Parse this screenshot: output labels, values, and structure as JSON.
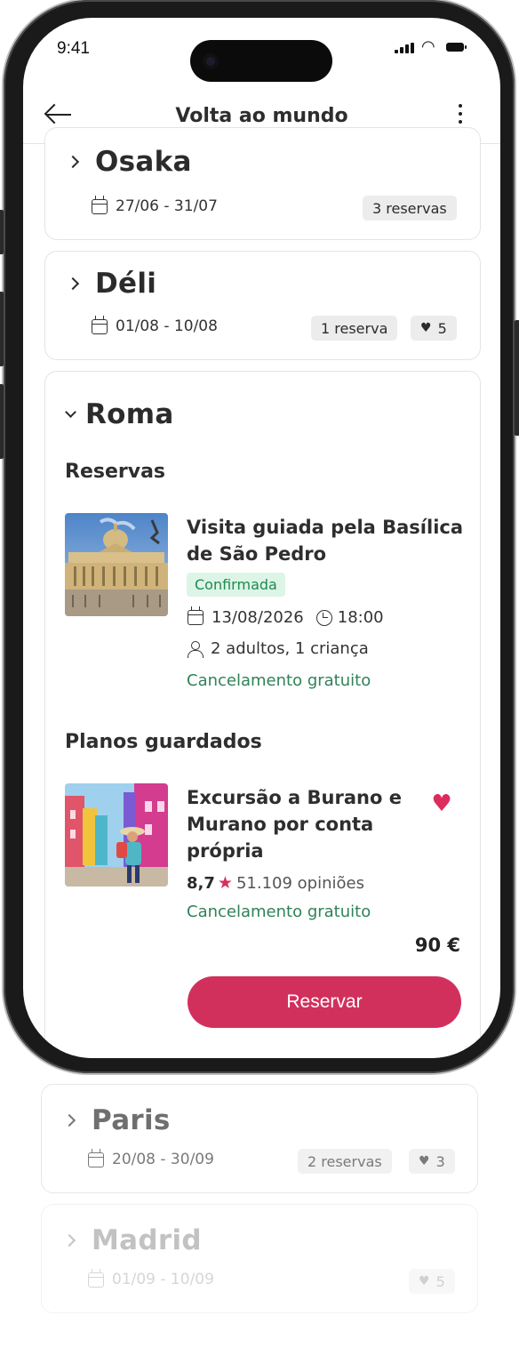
{
  "status_bar": {
    "time": "9:41"
  },
  "appbar": {
    "title": "Volta ao mundo",
    "back_icon": "arrow-left-icon",
    "menu_icon": "more-vertical-icon"
  },
  "destinations": [
    {
      "city": "Osaka",
      "dates": "27/06 - 31/07",
      "reservations": "3 reservas"
    },
    {
      "city": "Déli",
      "dates": "01/08 - 10/08",
      "reservations": "1 reserva",
      "saved": "5"
    },
    {
      "city": "Roma",
      "expanded": true
    },
    {
      "city": "Paris",
      "dates": "20/08 - 30/09",
      "reservations": "2 reservas",
      "saved": "3"
    },
    {
      "city": "Madrid",
      "dates": "01/09 - 10/09",
      "saved": "5"
    }
  ],
  "roma": {
    "reservations_title": "Reservas",
    "booking": {
      "title": "Visita guiada pela Basílica de São Pedro",
      "status": "Confirmada",
      "date": "13/08/2026",
      "time": "18:00",
      "guests": "2 adultos, 1 criança",
      "cancellation": "Cancelamento gratuito"
    },
    "saved_title": "Planos guardados",
    "plan": {
      "title": "Excursão a Burano e Murano por conta própria",
      "rating": "8,7",
      "reviews": "51.109 opiniões",
      "cancellation": "Cancelamento gratuito",
      "price": "90 €",
      "cta": "Reservar"
    }
  },
  "colors": {
    "accent": "#d2305c",
    "success": "#2f8259",
    "badge_bg": "#dcf5e6",
    "chip_bg": "#ececec"
  }
}
